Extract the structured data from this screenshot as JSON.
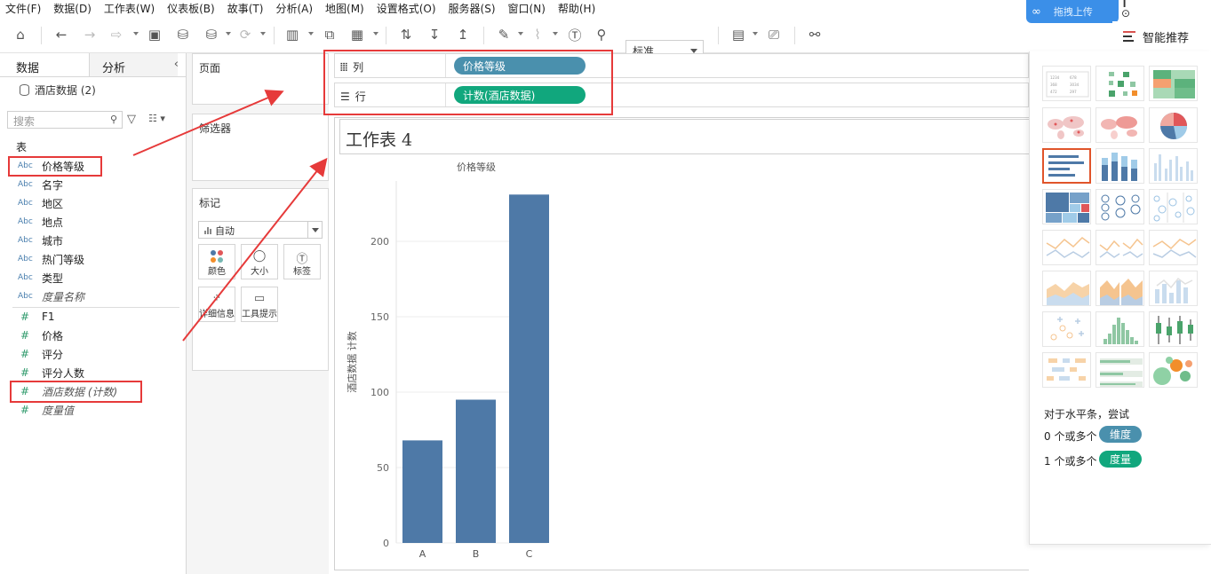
{
  "menu": [
    "文件(F)",
    "数据(D)",
    "工作表(W)",
    "仪表板(B)",
    "故事(T)",
    "分析(A)",
    "地图(M)",
    "设置格式(O)",
    "服务器(S)",
    "窗口(N)",
    "帮助(H)"
  ],
  "toolbar": {
    "fit_label": "标准",
    "upload_label": "拖拽上传",
    "smart_tab_label": "智能推荐"
  },
  "data_pane": {
    "tab_data": "数据",
    "tab_analysis": "分析",
    "datasource": "酒店数据 (2)",
    "search_placeholder": "搜索",
    "section_table": "表",
    "dimensions": [
      {
        "type": "Abc",
        "name": "价格等级"
      },
      {
        "type": "Abc",
        "name": "名字"
      },
      {
        "type": "Abc",
        "name": "地区"
      },
      {
        "type": "Abc",
        "name": "地点"
      },
      {
        "type": "Abc",
        "name": "城市"
      },
      {
        "type": "Abc",
        "name": "热门等级"
      },
      {
        "type": "Abc",
        "name": "类型"
      },
      {
        "type": "Abc",
        "name": "度量名称"
      }
    ],
    "measures": [
      {
        "type": "#",
        "name": "F1"
      },
      {
        "type": "#",
        "name": "价格"
      },
      {
        "type": "#",
        "name": "评分"
      },
      {
        "type": "#",
        "name": "评分人数"
      },
      {
        "type": "#",
        "name": "酒店数据 (计数)"
      },
      {
        "type": "#",
        "name": "度量值"
      }
    ]
  },
  "cards": {
    "pages": "页面",
    "filters": "筛选器",
    "marks": "标记",
    "marks_type": "自动",
    "mark_buttons": [
      "颜色",
      "大小",
      "标签",
      "详细信息",
      "工具提示"
    ]
  },
  "shelves": {
    "columns_label": "列",
    "rows_label": "行",
    "columns_pill": "价格等级",
    "rows_pill": "计数(酒店数据)"
  },
  "sheet": {
    "title": "工作表 4"
  },
  "chart_data": {
    "type": "bar",
    "title": "价格等级",
    "xlabel": "",
    "ylabel": "酒店数据 计数",
    "categories": [
      "A",
      "B",
      "C"
    ],
    "values": [
      68,
      95,
      231
    ],
    "ylim": [
      0,
      240
    ],
    "yticks": [
      0,
      50,
      100,
      150,
      200
    ],
    "grid": true,
    "bar_color": "#4e79a7"
  },
  "recommend": {
    "hint_line1": "对于水平条，尝试",
    "hint_line2_prefix": "0 个或多个",
    "hint_line2_pill": "维度",
    "hint_line3_prefix": "1 个或多个",
    "hint_line3_pill": "度量"
  },
  "colors": {
    "dimension_pill": "#4a90ad",
    "measure_pill": "#11a77d",
    "annotation_red": "#e63a3a",
    "selected_thumb": "#e0542a"
  }
}
